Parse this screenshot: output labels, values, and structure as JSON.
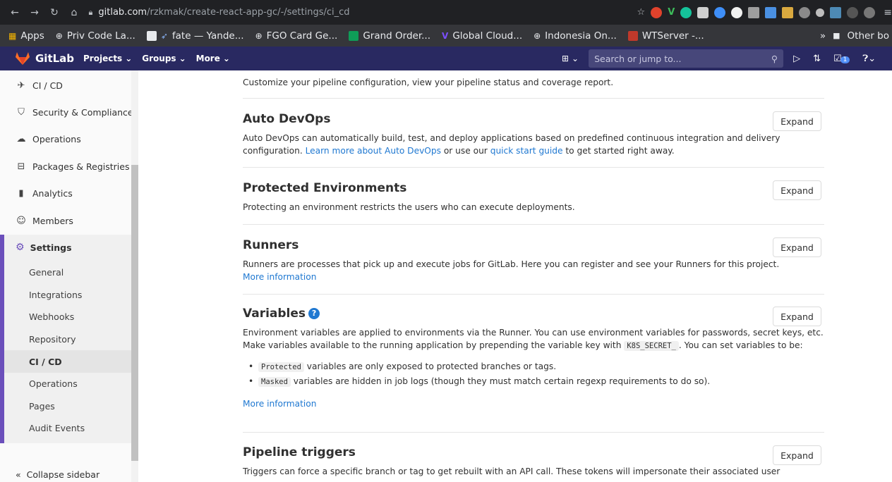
{
  "browser": {
    "url_host": "gitlab.com",
    "url_path": "/rzkmak/create-react-app-gc/-/settings/ci_cd",
    "bookmarks": [
      "Apps",
      "Priv Code La...",
      "fate — Yande...",
      "FGO Card Ge...",
      "Grand Order...",
      "Global Cloud...",
      "Indonesia On...",
      "WTServer -..."
    ],
    "bookmark_more": "»",
    "other_bookmarks": "Other bo"
  },
  "header": {
    "logo": "GitLab",
    "nav": [
      "Projects",
      "Groups",
      "More"
    ],
    "search_placeholder": "Search or jump to...",
    "todo_count": "1"
  },
  "sidebar": {
    "items": [
      "CI / CD",
      "Security & Compliance",
      "Operations",
      "Packages & Registries",
      "Analytics",
      "Members"
    ],
    "settings_title": "Settings",
    "settings_sub": [
      "General",
      "Integrations",
      "Webhooks",
      "Repository",
      "CI / CD",
      "Operations",
      "Pages",
      "Audit Events"
    ],
    "collapse": "Collapse sidebar"
  },
  "content": {
    "pipelines_desc": "Customize your pipeline configuration, view your pipeline status and coverage report.",
    "autodevops_title": "Auto DevOps",
    "autodevops_desc_1": "Auto DevOps can automatically build, test, and deploy applications based on predefined continuous integration and delivery configuration. ",
    "autodevops_link_1": "Learn more about Auto DevOps",
    "autodevops_desc_2": " or use our ",
    "autodevops_link_2": "quick start guide",
    "autodevops_desc_3": " to get started right away.",
    "protected_title": "Protected Environments",
    "protected_desc": "Protecting an environment restricts the users who can execute deployments.",
    "runners_title": "Runners",
    "runners_desc": "Runners are processes that pick up and execute jobs for GitLab. Here you can register and see your Runners for this project.",
    "runners_link": "More information",
    "variables_title": "Variables",
    "variables_desc_1": "Environment variables are applied to environments via the Runner. You can use environment variables for passwords, secret keys, etc. Make variables available to the running application by prepending the variable key with ",
    "variables_code": "K8S_SECRET_",
    "variables_desc_2": ". You can set variables to be:",
    "bullet_1_code": "Protected",
    "bullet_1_text": " variables are only exposed to protected branches or tags.",
    "bullet_2_code": "Masked",
    "bullet_2_text": " variables are hidden in job logs (though they must match certain regexp requirements to do so).",
    "variables_link": "More information",
    "triggers_title": "Pipeline triggers",
    "triggers_desc": "Triggers can force a specific branch or tag to get rebuilt with an API call. These tokens will impersonate their associated user",
    "expand_label": "Expand"
  }
}
